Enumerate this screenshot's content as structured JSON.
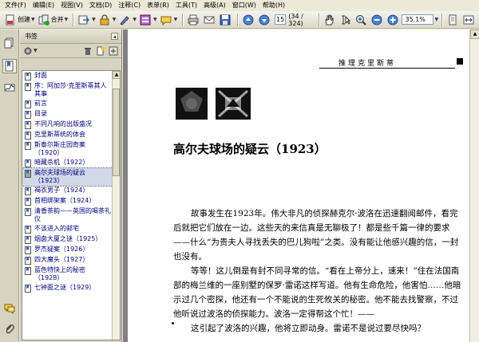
{
  "menu": [
    "文件(F)",
    "编辑(E)",
    "视图(V)",
    "文档(D)",
    "注释(C)",
    "表单(R)",
    "工具(T)",
    "高级(A)",
    "窗口(W)",
    "帮助(H)"
  ],
  "toolbar": {
    "create_label": "创建",
    "combine_label": "合并",
    "page_current": "15",
    "page_count": "(34 / 324)",
    "zoom_value": "35.1%"
  },
  "bookmarks": {
    "title": "书签",
    "collapse_label": "◂",
    "items": [
      {
        "label": "封面",
        "selected": false
      },
      {
        "label": "序：阿加莎·克里斯蒂其人其事",
        "selected": false
      },
      {
        "label": "前言",
        "selected": false
      },
      {
        "label": "目录",
        "selected": false
      },
      {
        "label": "不同凡响的出版盛况",
        "selected": false
      },
      {
        "label": "克里斯蒂统的体会",
        "selected": false
      },
      {
        "label": "斯泰尔斯庄园奇案（1920）",
        "selected": false
      },
      {
        "label": "暗藏杀机（1922）",
        "selected": false
      },
      {
        "label": "高尔夫球场的疑云（1923）",
        "selected": true
      },
      {
        "label": "褐衣男子（1924）",
        "selected": false
      },
      {
        "label": "首相绑架案（1924）",
        "selected": false
      },
      {
        "label": "清香茶韵——英国的喝茶礼仪",
        "selected": false
      },
      {
        "label": "不该进入的邮宅",
        "selected": false
      },
      {
        "label": "烟囱大厦之谜（1925）",
        "selected": false
      },
      {
        "label": "罗杰疑案（1926）",
        "selected": false
      },
      {
        "label": "四大魔头（1927）",
        "selected": false
      },
      {
        "label": "蓝色特快上的秘密（1928）",
        "selected": false
      },
      {
        "label": "七钟面之谜（1929）",
        "selected": false
      }
    ]
  },
  "document": {
    "running_head": "推理克里斯蒂",
    "chapter_title": "高尔夫球场的疑云（1923）",
    "paragraphs": [
      "故事发生在1923年。伟大非凡的侦探赫克尔·波洛在迅速翻阅邮件，看完后就把它们放在一边。这些天的来信真是无聊极了！都是些千篇一律的要求——什么“为贵夫人寻找丢失的巴儿狗啦”之类。没有能让他感兴趣的信，一封也没有。",
      "等等！这儿倒是有封不同寻常的信。“看在上帝分上，速来！”住在法国南部的梅兰维的一座别墅的保罗·雷诺这样写道。他有生命危险，他害怕……他暗示过几个密探，他还有一个不能说的生死攸关的秘密。他不能去找警察，不过他听说过波洛的侦探能力。波洛一定得帮这个忙！——",
      "这引起了波洛的兴趣，他将立即动身。雷诺不是说过要尽快吗？"
    ]
  }
}
